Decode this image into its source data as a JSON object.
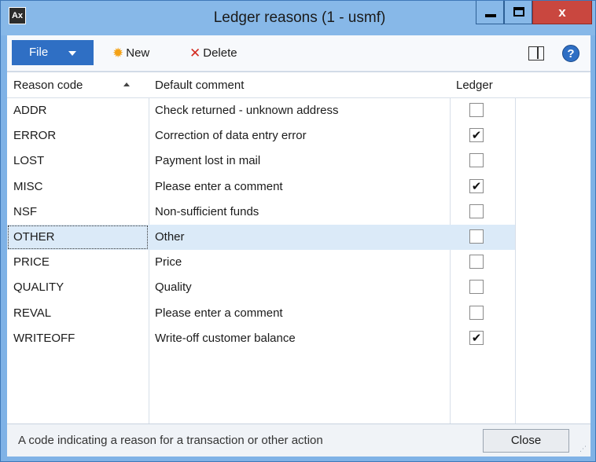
{
  "window": {
    "title": "Ledger reasons (1 - usmf)",
    "close_glyph": "x"
  },
  "toolbar": {
    "file_label": "File",
    "new_label": "New",
    "delete_label": "Delete",
    "help_glyph": "?"
  },
  "grid": {
    "columns": [
      "Reason code",
      "Default comment",
      "Ledger"
    ],
    "rows": [
      {
        "code": "ADDR",
        "comment": "Check returned - unknown address",
        "ledger": false
      },
      {
        "code": "ERROR",
        "comment": "Correction of data entry error",
        "ledger": true
      },
      {
        "code": "LOST",
        "comment": "Payment lost in mail",
        "ledger": false
      },
      {
        "code": "MISC",
        "comment": "Please enter a comment",
        "ledger": true
      },
      {
        "code": "NSF",
        "comment": "Non-sufficient funds",
        "ledger": false
      },
      {
        "code": "OTHER",
        "comment": "Other",
        "ledger": false,
        "selected": true
      },
      {
        "code": "PRICE",
        "comment": "Price",
        "ledger": false
      },
      {
        "code": "QUALITY",
        "comment": "Quality",
        "ledger": false
      },
      {
        "code": "REVAL",
        "comment": "Please enter a comment",
        "ledger": false
      },
      {
        "code": "WRITEOFF",
        "comment": "Write-off customer balance",
        "ledger": true
      }
    ]
  },
  "status": {
    "text": "A code indicating a reason for a transaction or other action",
    "close_label": "Close"
  },
  "icons": {
    "app": "app-icon",
    "new": "sun-icon",
    "delete": "x-icon",
    "panel": "panel-icon",
    "help": "help-icon",
    "sort": "sort-ascending-icon"
  },
  "colors": {
    "titlebar": "#87b8e8",
    "file_button": "#2f6fc4",
    "close_button": "#c9473f",
    "selected_row": "#dbeaf8"
  }
}
